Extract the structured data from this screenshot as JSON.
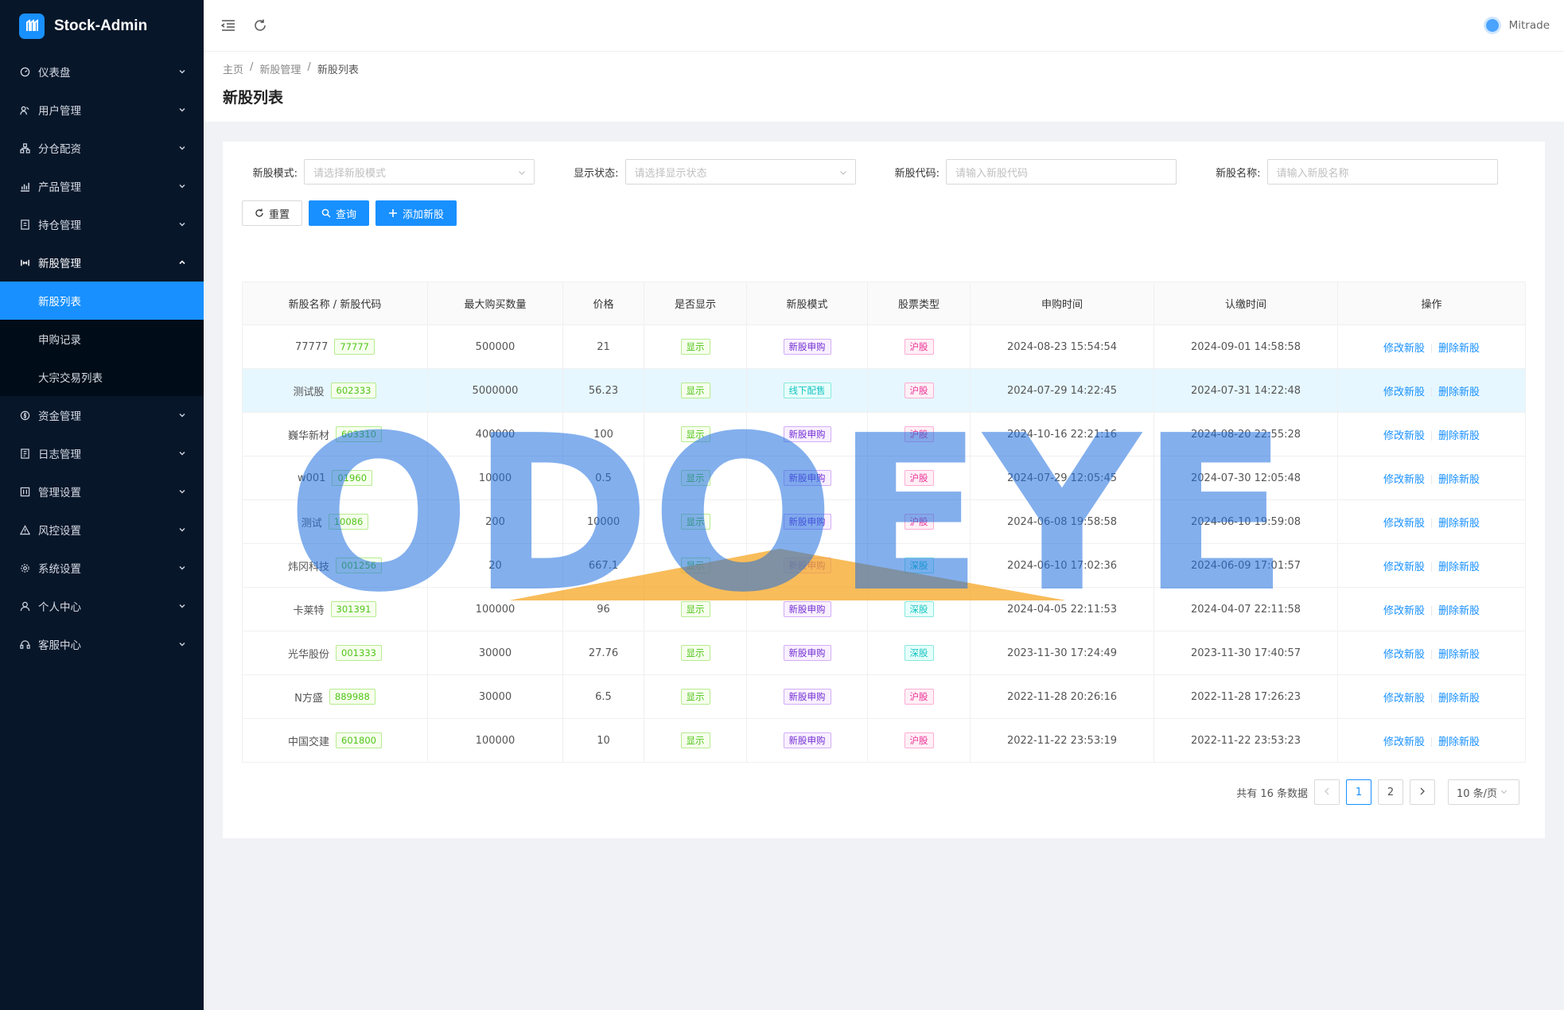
{
  "app": {
    "name": "Stock-Admin"
  },
  "sidebar": {
    "items": [
      {
        "label": "仪表盘"
      },
      {
        "label": "用户管理"
      },
      {
        "label": "分仓配资"
      },
      {
        "label": "产品管理"
      },
      {
        "label": "持仓管理"
      },
      {
        "label": "新股管理",
        "children": [
          {
            "label": "新股列表"
          },
          {
            "label": "申购记录"
          },
          {
            "label": "大宗交易列表"
          }
        ]
      },
      {
        "label": "资金管理"
      },
      {
        "label": "日志管理"
      },
      {
        "label": "管理设置"
      },
      {
        "label": "风控设置"
      },
      {
        "label": "系统设置"
      },
      {
        "label": "个人中心"
      },
      {
        "label": "客服中心"
      }
    ]
  },
  "header": {
    "user": "Mitrade"
  },
  "breadcrumb": [
    "主页",
    "新股管理",
    "新股列表"
  ],
  "page_title": "新股列表",
  "filters": {
    "mode": {
      "label": "新股模式:",
      "placeholder": "请选择新股模式"
    },
    "display": {
      "label": "显示状态:",
      "placeholder": "请选择显示状态"
    },
    "code": {
      "label": "新股代码:",
      "placeholder": "请输入新股代码"
    },
    "name": {
      "label": "新股名称:",
      "placeholder": "请输入新股名称"
    }
  },
  "buttons": {
    "reset": "重置",
    "query": "查询",
    "add": "添加新股"
  },
  "table": {
    "columns": [
      "新股名称 / 新股代码",
      "最大购买数量",
      "价格",
      "是否显示",
      "新股模式",
      "股票类型",
      "申购时间",
      "认缴时间",
      "操作"
    ],
    "edit_label": "修改新股",
    "delete_label": "删除新股",
    "rows": [
      {
        "name": "77777",
        "code": "77777",
        "max": "500000",
        "price": "21",
        "show": "显示",
        "mode": "新股申购",
        "type": "沪股",
        "apply": "2024-08-23 15:54:54",
        "pay": "2024-09-01 14:58:58"
      },
      {
        "name": "测试股",
        "code": "602333",
        "max": "5000000",
        "price": "56.23",
        "show": "显示",
        "mode": "线下配售",
        "type": "沪股",
        "apply": "2024-07-29 14:22:45",
        "pay": "2024-07-31 14:22:48"
      },
      {
        "name": "巍华新材",
        "code": "603310",
        "max": "400000",
        "price": "100",
        "show": "显示",
        "mode": "新股申购",
        "type": "沪股",
        "apply": "2024-10-16 22:21:16",
        "pay": "2024-08-20 22:55:28"
      },
      {
        "name": "w001",
        "code": "01960",
        "max": "10000",
        "price": "0.5",
        "show": "显示",
        "mode": "新股申购",
        "type": "沪股",
        "apply": "2024-07-29 12:05:45",
        "pay": "2024-07-30 12:05:48"
      },
      {
        "name": "测试",
        "code": "10086",
        "max": "200",
        "price": "10000",
        "show": "显示",
        "mode": "新股申购",
        "type": "沪股",
        "apply": "2024-06-08 19:58:58",
        "pay": "2024-06-10 19:59:08"
      },
      {
        "name": "炜冈科技",
        "code": "001256",
        "max": "20",
        "price": "667.1",
        "show": "显示",
        "mode": "新股申购",
        "type": "深股",
        "apply": "2024-06-10 17:02:36",
        "pay": "2024-06-09 17:01:57"
      },
      {
        "name": "卡莱特",
        "code": "301391",
        "max": "100000",
        "price": "96",
        "show": "显示",
        "mode": "新股申购",
        "type": "深股",
        "apply": "2024-04-05 22:11:53",
        "pay": "2024-04-07 22:11:58"
      },
      {
        "name": "光华股份",
        "code": "001333",
        "max": "30000",
        "price": "27.76",
        "show": "显示",
        "mode": "新股申购",
        "type": "深股",
        "apply": "2023-11-30 17:24:49",
        "pay": "2023-11-30 17:40:57"
      },
      {
        "name": "N方盛",
        "code": "889988",
        "max": "30000",
        "price": "6.5",
        "show": "显示",
        "mode": "新股申购",
        "type": "沪股",
        "apply": "2022-11-28 20:26:16",
        "pay": "2022-11-28 17:26:23"
      },
      {
        "name": "中国交建",
        "code": "601800",
        "max": "100000",
        "price": "10",
        "show": "显示",
        "mode": "新股申购",
        "type": "沪股",
        "apply": "2022-11-22 23:53:19",
        "pay": "2022-11-22 23:53:23"
      }
    ]
  },
  "pagination": {
    "total_text": "共有 16 条数据",
    "pages": [
      "1",
      "2"
    ],
    "current": "1",
    "page_size": "10 条/页"
  },
  "watermark": {
    "text": "ODOEYE",
    "color": "#1e6fe0"
  }
}
